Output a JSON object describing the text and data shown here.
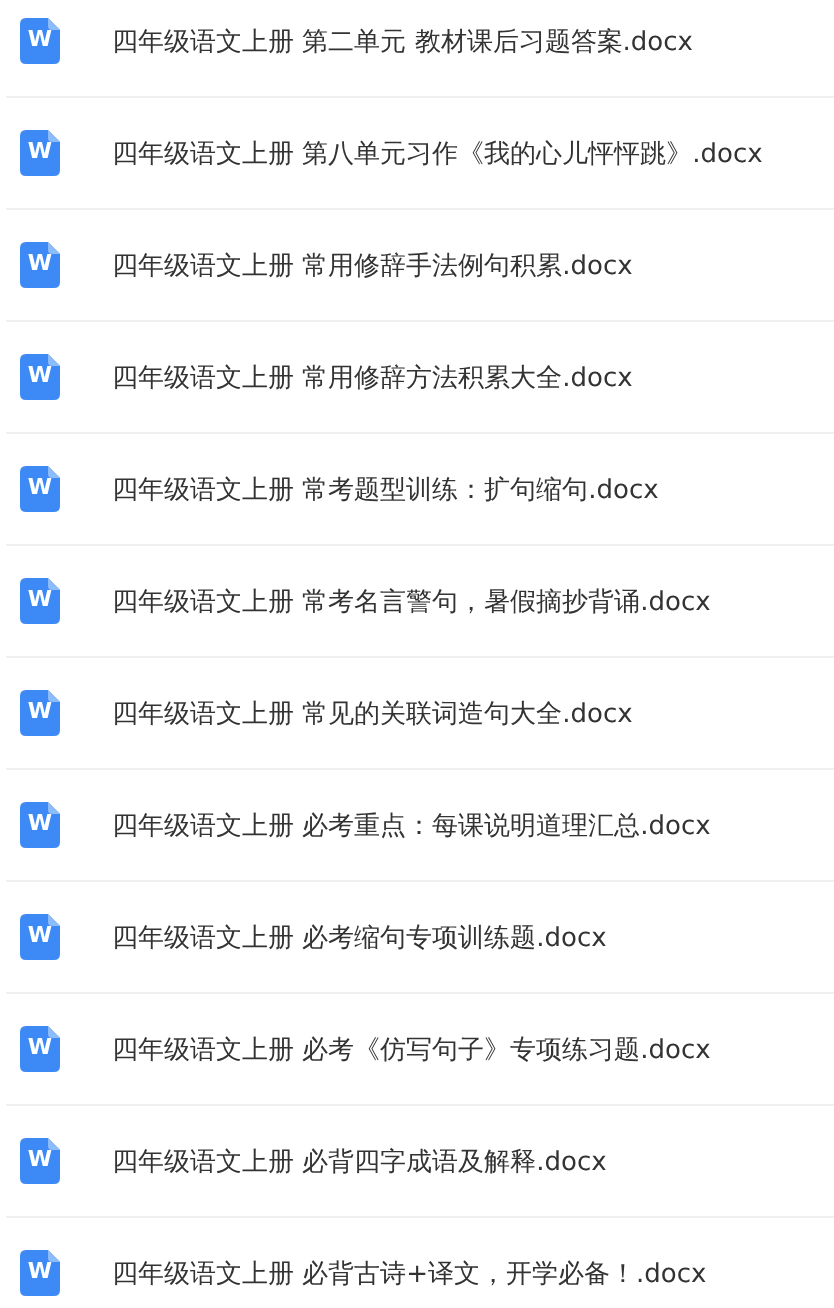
{
  "files": [
    {
      "name": "四年级语文上册 第二单元 教材课后习题答案.docx",
      "icon_letter": "W"
    },
    {
      "name": "四年级语文上册 第八单元习作《我的心儿怦怦跳》.docx",
      "icon_letter": "W"
    },
    {
      "name": "四年级语文上册 常用修辞手法例句积累.docx",
      "icon_letter": "W"
    },
    {
      "name": "四年级语文上册 常用修辞方法积累大全.docx",
      "icon_letter": "W"
    },
    {
      "name": "四年级语文上册 常考题型训练：扩句缩句.docx",
      "icon_letter": "W"
    },
    {
      "name": "四年级语文上册 常考名言警句，暑假摘抄背诵.docx",
      "icon_letter": "W"
    },
    {
      "name": "四年级语文上册 常见的关联词造句大全.docx",
      "icon_letter": "W"
    },
    {
      "name": "四年级语文上册 必考重点：每课说明道理汇总.docx",
      "icon_letter": "W"
    },
    {
      "name": "四年级语文上册 必考缩句专项训练题.docx",
      "icon_letter": "W"
    },
    {
      "name": "四年级语文上册 必考《仿写句子》专项练习题.docx",
      "icon_letter": "W"
    },
    {
      "name": "四年级语文上册 必背四字成语及解释.docx",
      "icon_letter": "W"
    },
    {
      "name": "四年级语文上册 必背古诗+译文，开学必备！.docx",
      "icon_letter": "W"
    }
  ]
}
